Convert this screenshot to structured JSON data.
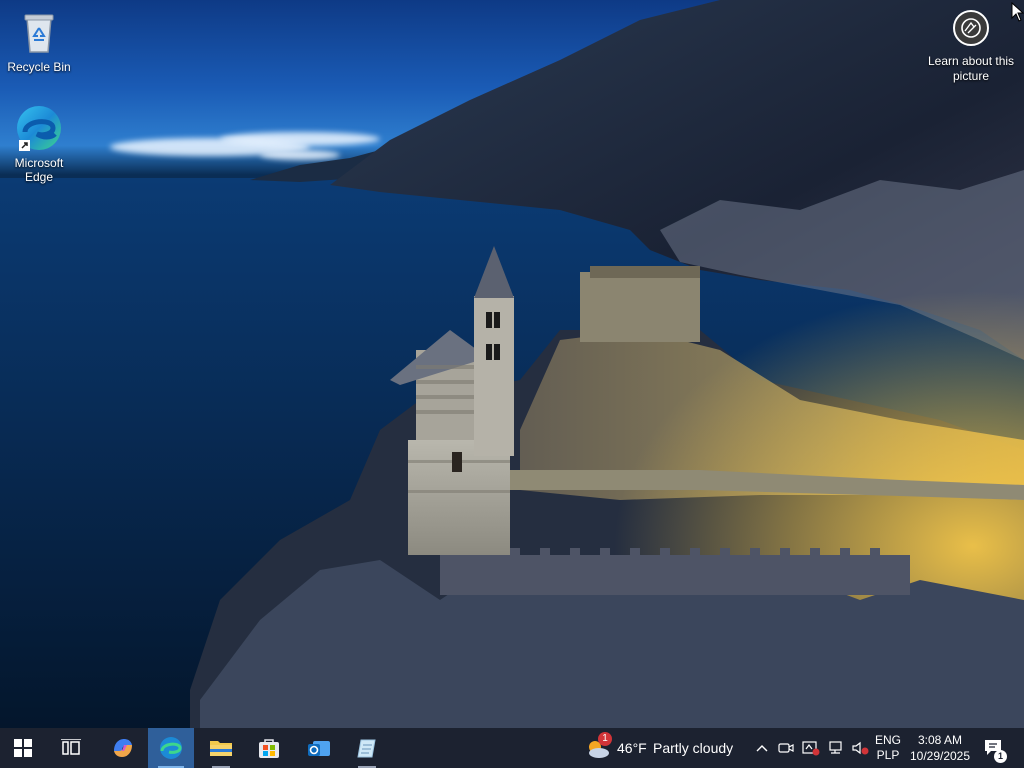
{
  "desktop": {
    "icons": [
      {
        "label": "Recycle Bin",
        "icon": "recycle-bin-icon"
      },
      {
        "label": "Microsoft Edge",
        "icon": "edge-icon"
      }
    ],
    "learn_about": {
      "label": "Learn about this picture",
      "icon": "camera-icon"
    }
  },
  "taskbar": {
    "apps": [
      {
        "name": "Start",
        "icon": "windows-logo-icon"
      },
      {
        "name": "Task View",
        "icon": "task-view-icon"
      },
      {
        "name": "Copilot",
        "icon": "copilot-icon"
      },
      {
        "name": "Microsoft Edge",
        "icon": "edge-icon",
        "active": true
      },
      {
        "name": "File Explorer",
        "icon": "folder-icon"
      },
      {
        "name": "Microsoft Store",
        "icon": "store-icon"
      },
      {
        "name": "Outlook",
        "icon": "outlook-icon"
      },
      {
        "name": "Notepad",
        "icon": "notepad-icon"
      }
    ],
    "weather": {
      "temp": "46°F",
      "condition": "Partly cloudy",
      "badge": "1"
    },
    "tray": {
      "lang_1": "ENG",
      "lang_2": "PLP",
      "time": "3:08 AM",
      "date": "10/29/2025",
      "notification_count": "1"
    }
  },
  "colors": {
    "taskbar_bg": "#1c2230",
    "active_app_bg": "#2f5f9a",
    "accent": "#7eb4ea"
  }
}
